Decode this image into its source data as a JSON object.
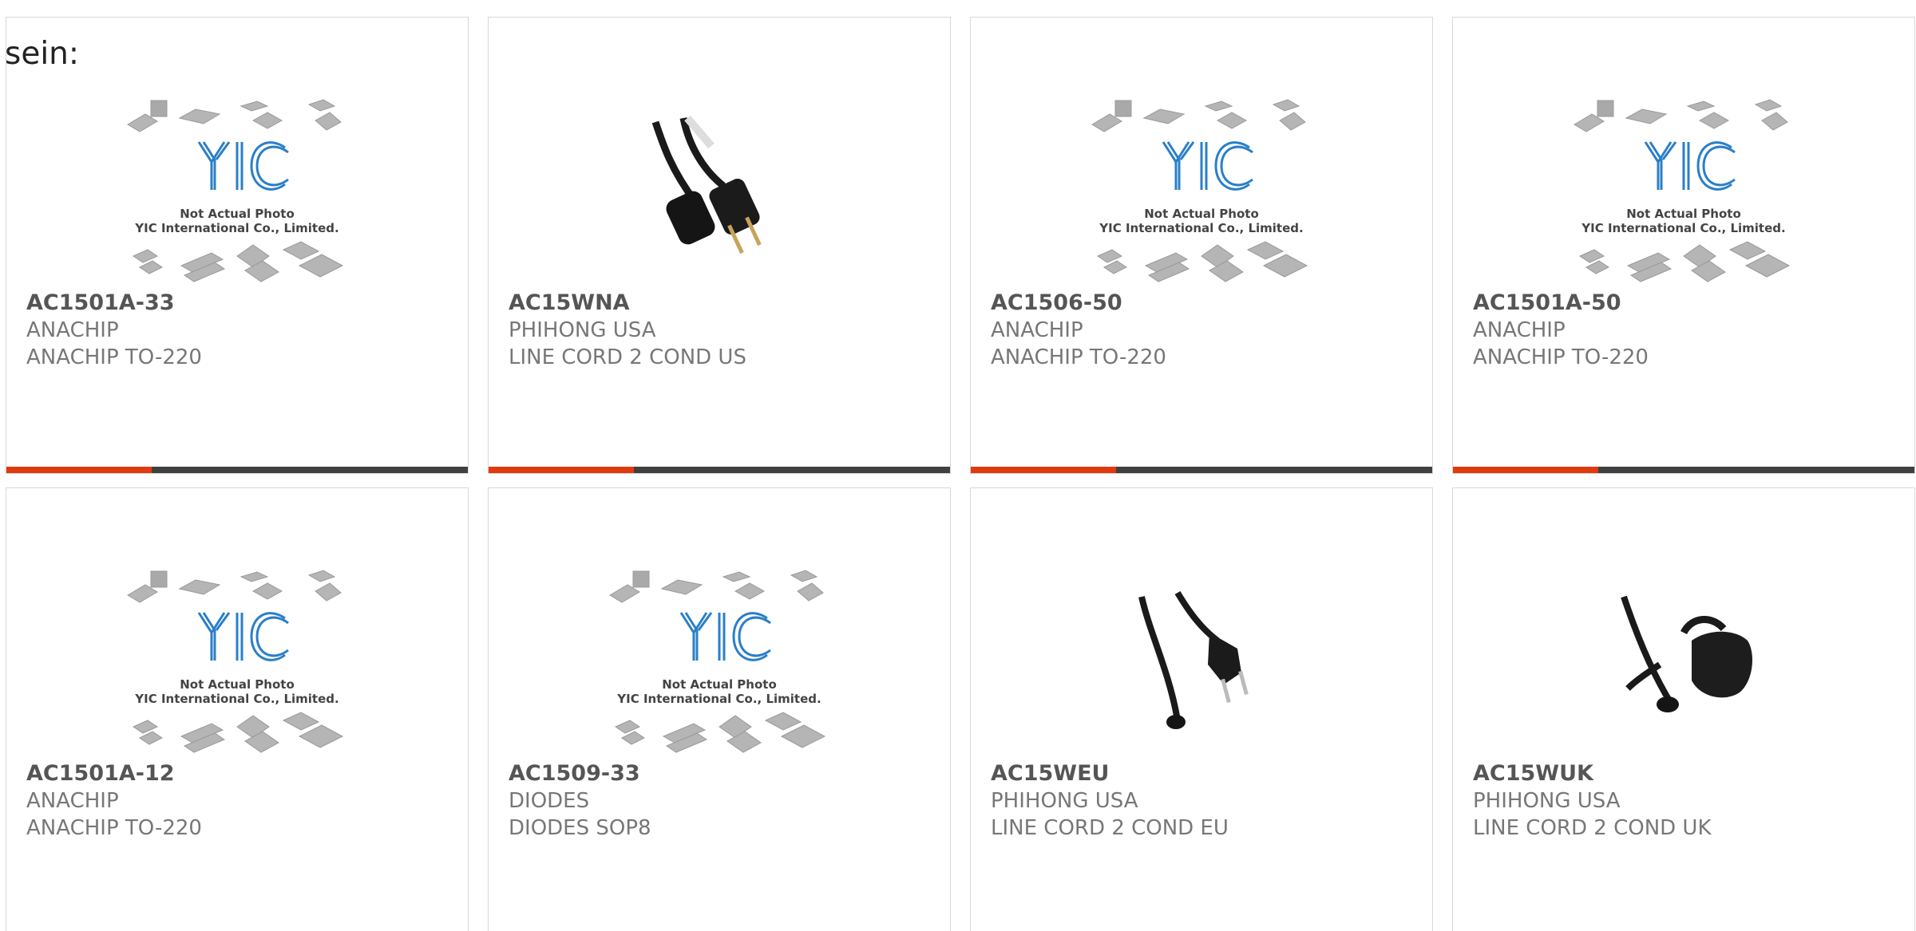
{
  "lead_text": "sein:",
  "placeholder_image": {
    "line1": "Not Actual Photo",
    "line2": "YIC International Co., Limited.",
    "logo": "YIC"
  },
  "products": [
    {
      "part_number": "AC1501A-33",
      "manufacturer": "ANACHIP",
      "description": "ANACHIP TO-220",
      "image": "placeholder"
    },
    {
      "part_number": "AC15WNA",
      "manufacturer": "PHIHONG USA",
      "description": "LINE CORD 2 COND US",
      "image": "us-plug-cord"
    },
    {
      "part_number": "AC1506-50",
      "manufacturer": "ANACHIP",
      "description": "ANACHIP TO-220",
      "image": "placeholder"
    },
    {
      "part_number": "AC1501A-50",
      "manufacturer": "ANACHIP",
      "description": "ANACHIP TO-220",
      "image": "placeholder"
    },
    {
      "part_number": "AC1501A-12",
      "manufacturer": "ANACHIP",
      "description": "ANACHIP TO-220",
      "image": "placeholder"
    },
    {
      "part_number": "AC1509-33",
      "manufacturer": "DIODES",
      "description": "DIODES SOP8",
      "image": "placeholder"
    },
    {
      "part_number": "AC15WEU",
      "manufacturer": "PHIHONG USA",
      "description": "LINE CORD 2 COND EU",
      "image": "eu-plug-cord"
    },
    {
      "part_number": "AC15WUK",
      "manufacturer": "PHIHONG USA",
      "description": "LINE CORD 2 COND UK",
      "image": "uk-plug-cord"
    }
  ],
  "colors": {
    "accent": "#e13a0f",
    "bar": "#404040",
    "logo_blue": "#2a7fc8"
  }
}
